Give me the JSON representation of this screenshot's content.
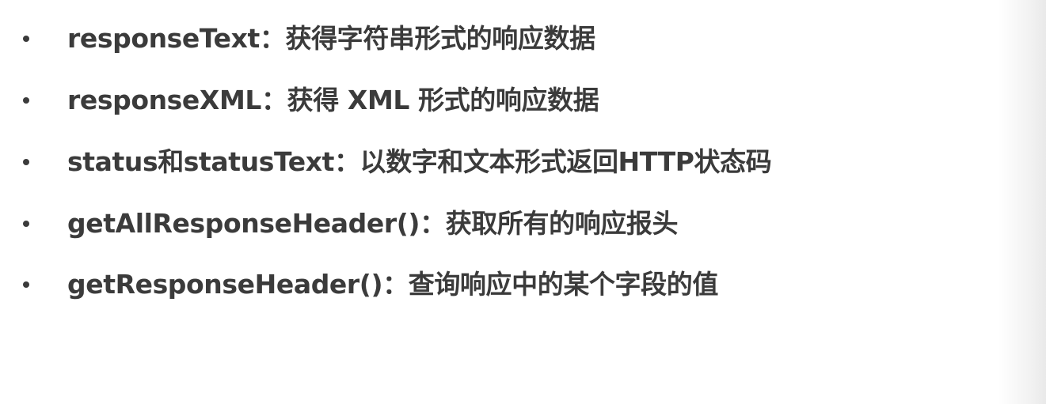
{
  "bullets": [
    {
      "text": "responseText：获得字符串形式的响应数据"
    },
    {
      "text": "responseXML：获得 XML 形式的响应数据"
    },
    {
      "text": "status和statusText：以数字和文本形式返回HTTP状态码"
    },
    {
      "text": "getAllResponseHeader()：获取所有的响应报头"
    },
    {
      "text": "getResponseHeader()：查询响应中的某个字段的值"
    }
  ],
  "colors": {
    "text": "#3b3b3b",
    "background": "#ffffff"
  }
}
